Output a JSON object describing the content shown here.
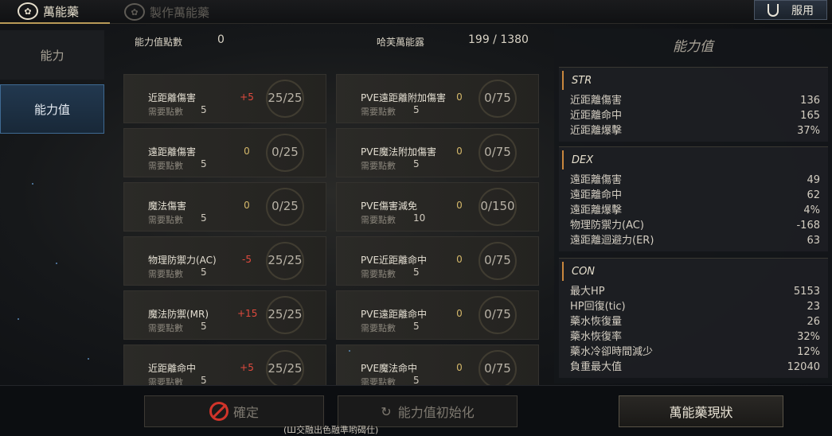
{
  "tabs": [
    {
      "label": "萬能藥",
      "icon": "potion-icon"
    },
    {
      "label": "製作萬能藥",
      "icon": "craft-potion-icon"
    }
  ],
  "use_button": {
    "label": "服用",
    "icon": "flask-icon"
  },
  "sidebar": {
    "items": [
      {
        "label": "能力"
      },
      {
        "label": "能力值"
      }
    ]
  },
  "header": {
    "points_label": "能力值點數",
    "points_value": "0",
    "elixir_label": "哈芙萬能露",
    "elixir_value": "199 / 1380"
  },
  "cards": [
    {
      "name": "近距離傷害",
      "cost_label": "需要點數",
      "cost": "5",
      "bonus": "+5",
      "bonus_color": "red",
      "level": "25/25"
    },
    {
      "name": "PVE遠距離附加傷害",
      "cost_label": "需要點數",
      "cost": "5",
      "bonus": "0",
      "bonus_color": "gold",
      "level": "0/75"
    },
    {
      "name": "遠距離傷害",
      "cost_label": "需要點數",
      "cost": "5",
      "bonus": "0",
      "bonus_color": "gold",
      "level": "0/25"
    },
    {
      "name": "PVE魔法附加傷害",
      "cost_label": "需要點數",
      "cost": "5",
      "bonus": "0",
      "bonus_color": "gold",
      "level": "0/75"
    },
    {
      "name": "魔法傷害",
      "cost_label": "需要點數",
      "cost": "5",
      "bonus": "0",
      "bonus_color": "gold",
      "level": "0/25"
    },
    {
      "name": "PVE傷害減免",
      "cost_label": "需要點數",
      "cost": "10",
      "bonus": "0",
      "bonus_color": "gold",
      "level": "0/150"
    },
    {
      "name": "物理防禦力(AC)",
      "cost_label": "需要點數",
      "cost": "5",
      "bonus": "-5",
      "bonus_color": "red",
      "level": "25/25"
    },
    {
      "name": "PVE近距離命中",
      "cost_label": "需要點數",
      "cost": "5",
      "bonus": "0",
      "bonus_color": "gold",
      "level": "0/75"
    },
    {
      "name": "魔法防禦(MR)",
      "cost_label": "需要點數",
      "cost": "5",
      "bonus": "+15",
      "bonus_color": "red",
      "level": "25/25"
    },
    {
      "name": "PVE遠距離命中",
      "cost_label": "需要點數",
      "cost": "5",
      "bonus": "0",
      "bonus_color": "gold",
      "level": "0/75"
    },
    {
      "name": "近距離命中",
      "cost_label": "需要點數",
      "cost": "5",
      "bonus": "+5",
      "bonus_color": "red",
      "level": "25/25"
    },
    {
      "name": "PVE魔法命中",
      "cost_label": "需要點數",
      "cost": "5",
      "bonus": "0",
      "bonus_color": "gold",
      "level": "0/75"
    }
  ],
  "panel": {
    "title": "能力值",
    "sections": [
      {
        "title": "STR",
        "rows": [
          {
            "k": "近距離傷害",
            "v": "136"
          },
          {
            "k": "近距離命中",
            "v": "165"
          },
          {
            "k": "近距離爆擊",
            "v": "37%"
          }
        ]
      },
      {
        "title": "DEX",
        "rows": [
          {
            "k": "遠距離傷害",
            "v": "49"
          },
          {
            "k": "遠距離命中",
            "v": "62"
          },
          {
            "k": "遠距離爆擊",
            "v": "4%"
          },
          {
            "k": "物理防禦力(AC)",
            "v": "-168"
          },
          {
            "k": "遠距離迴避力(ER)",
            "v": "63"
          }
        ]
      },
      {
        "title": "CON",
        "rows": [
          {
            "k": "最大HP",
            "v": "5153"
          },
          {
            "k": "HP回復(tic)",
            "v": "23"
          },
          {
            "k": "藥水恢復量",
            "v": "26"
          },
          {
            "k": "藥水恢復率",
            "v": "32%"
          },
          {
            "k": "藥水冷卻時間減少",
            "v": "12%"
          },
          {
            "k": "負重最大值",
            "v": "12040"
          }
        ]
      }
    ]
  },
  "bottom": {
    "confirm_label": "確定",
    "reset_label": "能力值初始化",
    "status_label": "萬能藥現狀"
  },
  "subtitle": "(Ш交融出色融準哟碣仕)"
}
